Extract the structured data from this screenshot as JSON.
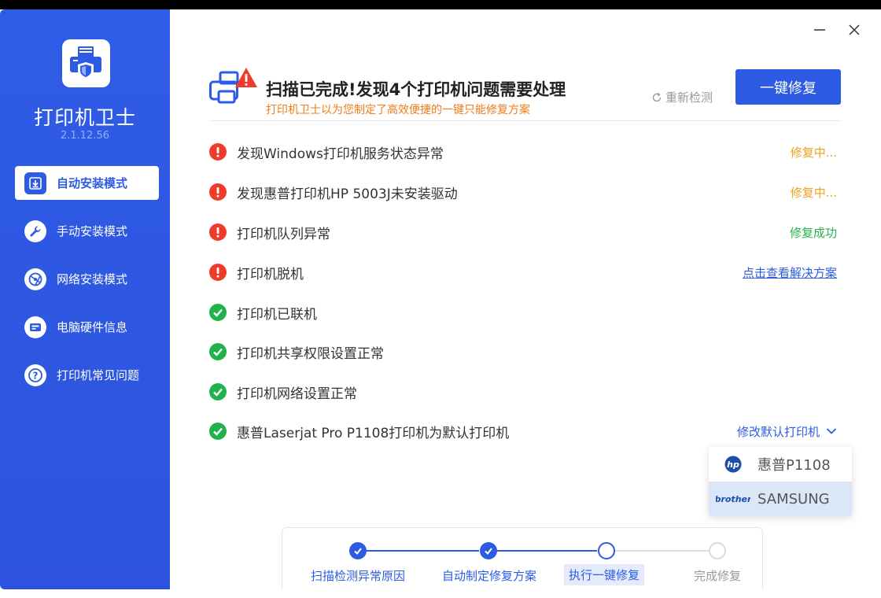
{
  "app": {
    "title": "打印机卫士",
    "version": "2.1.12.56"
  },
  "sidebar": {
    "items": [
      {
        "label": "自动安装模式",
        "icon": "download-box-icon",
        "active": true
      },
      {
        "label": "手动安装模式",
        "icon": "wrench-icon",
        "active": false
      },
      {
        "label": "网络安装模式",
        "icon": "network-icon",
        "active": false
      },
      {
        "label": "电脑硬件信息",
        "icon": "hardware-icon",
        "active": false
      },
      {
        "label": "打印机常见问题",
        "icon": "question-icon",
        "active": false
      }
    ]
  },
  "header": {
    "title": "扫描已完成!发现4个打印机问题需要处理",
    "subtitle": "打印机卫士以为您制定了高效便捷的一键只能修复方案",
    "recheck_label": "重新检测",
    "fix_button": "一键修复"
  },
  "issues": [
    {
      "text": "发现Windows打印机服务状态异常",
      "state": "error",
      "status": "修复中...",
      "status_type": "orange"
    },
    {
      "text": "发现惠普打印机HP 5003J未安装驱动",
      "state": "error",
      "status": "修复中...",
      "status_type": "orange"
    },
    {
      "text": "打印机队列异常",
      "state": "error",
      "status": "修复成功",
      "status_type": "green"
    },
    {
      "text": "打印机脱机",
      "state": "error",
      "status": "点击查看解决方案",
      "status_type": "link"
    },
    {
      "text": "打印机已联机",
      "state": "ok",
      "status": "",
      "status_type": ""
    },
    {
      "text": "打印机共享权限设置正常",
      "state": "ok",
      "status": "",
      "status_type": ""
    },
    {
      "text": "打印机网络设置正常",
      "state": "ok",
      "status": "",
      "status_type": ""
    },
    {
      "text": "惠普Laserjat Pro P1108打印机为默认打印机",
      "state": "ok",
      "status": "修改默认打印机",
      "status_type": "select"
    }
  ],
  "dropdown": {
    "options": [
      {
        "label": "惠普P1108",
        "logo": "hp",
        "selected": false
      },
      {
        "label": "SAMSUNG",
        "logo": "brother",
        "selected": true
      }
    ]
  },
  "steps": [
    {
      "label": "扫描检测异常原因",
      "state": "done"
    },
    {
      "label": "自动制定修复方案",
      "state": "done"
    },
    {
      "label": "执行一键修复",
      "state": "current"
    },
    {
      "label": "完成修复",
      "state": "pending"
    }
  ],
  "colors": {
    "primary": "#2d5be3",
    "error": "#ee3b2c",
    "ok": "#22b24c",
    "warn": "#f0a020"
  }
}
